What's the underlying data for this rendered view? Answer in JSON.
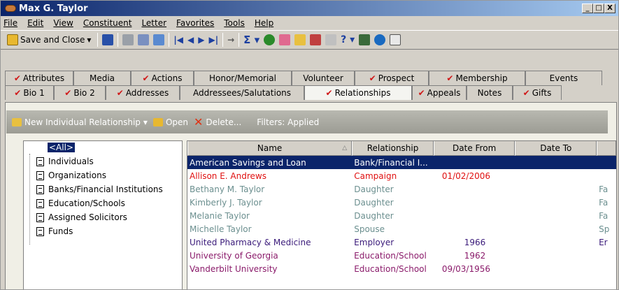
{
  "window": {
    "title": "Max G. Taylor",
    "controls": [
      "_",
      "□",
      "X"
    ]
  },
  "menu": [
    "File",
    "Edit",
    "View",
    "Constituent",
    "Letter",
    "Favorites",
    "Tools",
    "Help"
  ],
  "toolbar": {
    "save_close": "Save and Close"
  },
  "tabs_row1": [
    {
      "label": "Attributes",
      "check": true
    },
    {
      "label": "Media",
      "check": false
    },
    {
      "label": "Actions",
      "check": true
    },
    {
      "label": "Honor/Memorial",
      "check": false
    },
    {
      "label": "Volunteer",
      "check": false
    },
    {
      "label": "Prospect",
      "check": true
    },
    {
      "label": "Membership",
      "check": true
    },
    {
      "label": "Events",
      "check": false
    }
  ],
  "tabs_row2": [
    {
      "label": "Bio 1",
      "check": true
    },
    {
      "label": "Bio 2",
      "check": true
    },
    {
      "label": "Addresses",
      "check": true
    },
    {
      "label": "Addressees/Salutations",
      "check": false
    },
    {
      "label": "Relationships",
      "check": true,
      "active": true
    },
    {
      "label": "Appeals",
      "check": true
    },
    {
      "label": "Notes",
      "check": false
    },
    {
      "label": "Gifts",
      "check": true
    }
  ],
  "actionbar": {
    "new": "New Individual Relationship",
    "open": "Open",
    "delete": "Delete...",
    "filters": "Filters: Applied"
  },
  "tree": {
    "root": "<All>",
    "items": [
      "Individuals",
      "Organizations",
      "Banks/Financial Institutions",
      "Education/Schools",
      "Assigned Solicitors",
      "Funds"
    ]
  },
  "grid": {
    "columns": [
      "Name",
      "Relationship",
      "Date From",
      "Date To"
    ],
    "rows": [
      {
        "name": "American Savings and Loan",
        "relationship": "Bank/Financial I...",
        "from": "",
        "to": "",
        "extra": "",
        "color": "#ffffff",
        "selected": true
      },
      {
        "name": "Allison E. Andrews",
        "relationship": "Campaign",
        "from": "01/02/2006",
        "to": "",
        "extra": "",
        "color": "#e01010"
      },
      {
        "name": "Bethany M. Taylor",
        "relationship": "Daughter",
        "from": "",
        "to": "",
        "extra": "Fa",
        "color": "#6b8f8f"
      },
      {
        "name": "Kimberly J. Taylor",
        "relationship": "Daughter",
        "from": "",
        "to": "",
        "extra": "Fa",
        "color": "#6b8f8f"
      },
      {
        "name": "Melanie Taylor",
        "relationship": "Daughter",
        "from": "",
        "to": "",
        "extra": "Fa",
        "color": "#6b8f8f"
      },
      {
        "name": "Michelle Taylor",
        "relationship": "Spouse",
        "from": "",
        "to": "",
        "extra": "Sp",
        "color": "#6b8f8f"
      },
      {
        "name": "United Pharmacy & Medicine",
        "relationship": "Employer",
        "from": "1966",
        "to": "",
        "extra": "Er",
        "color": "#3a1a7a"
      },
      {
        "name": "University of Georgia",
        "relationship": "Education/School",
        "from": "1962",
        "to": "",
        "extra": "",
        "color": "#8a1a6a"
      },
      {
        "name": "Vanderbilt University",
        "relationship": "Education/School",
        "from": "09/03/1956",
        "to": "",
        "extra": "",
        "color": "#8a1a6a"
      }
    ]
  }
}
